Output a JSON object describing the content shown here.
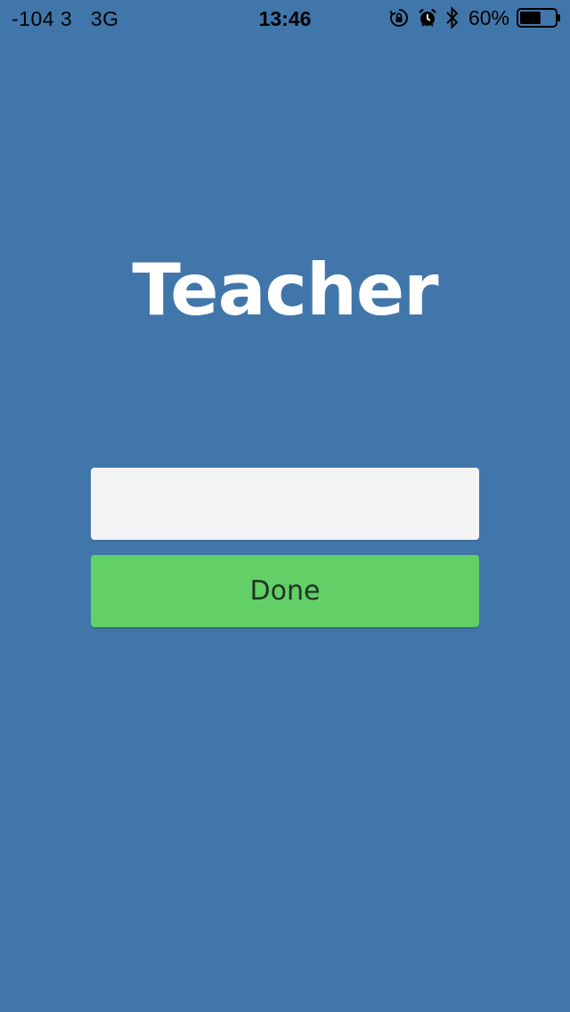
{
  "status_bar": {
    "signal": "-104 3",
    "network": "3G",
    "time": "13:46",
    "battery_percent": "60%",
    "battery_level": 0.6,
    "icons": [
      "orientation-lock-icon",
      "alarm-icon",
      "bluetooth-icon",
      "battery-icon"
    ]
  },
  "screen": {
    "title": "Teacher",
    "input_value": "",
    "input_placeholder": "",
    "done_label": "Done"
  },
  "colors": {
    "background": "#4176aa",
    "input_background": "#f4f4f4",
    "button_background": "#62d066",
    "title_color": "#ffffff"
  }
}
